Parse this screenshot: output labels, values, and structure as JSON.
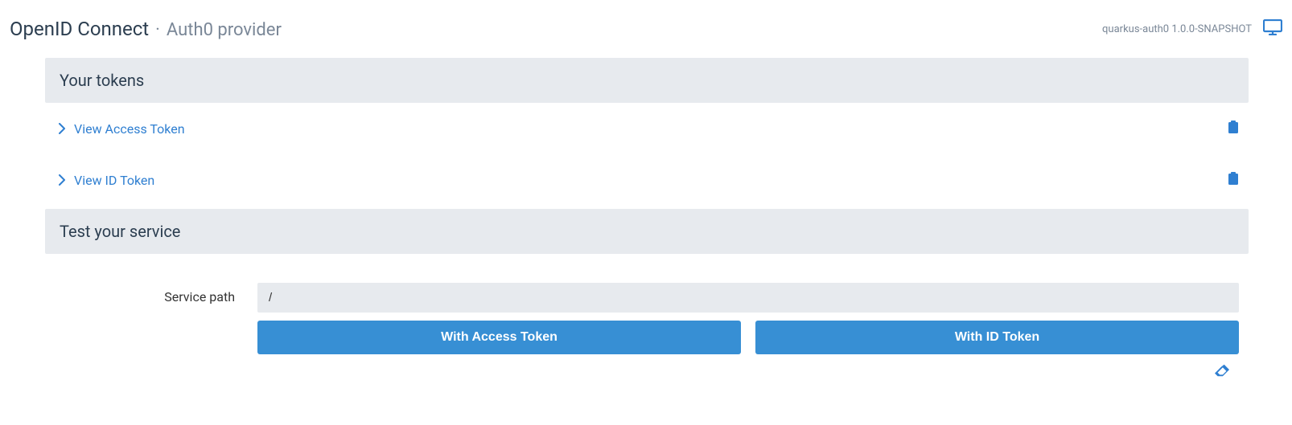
{
  "header": {
    "title": "OpenID Connect",
    "separator": "·",
    "subtitle": "Auth0 provider",
    "app_info": "quarkus-auth0 1.0.0-SNAPSHOT"
  },
  "tokens_section": {
    "heading": "Your tokens",
    "items": [
      {
        "label": "View Access Token"
      },
      {
        "label": "View ID Token"
      }
    ]
  },
  "service_section": {
    "heading": "Test your service",
    "path_label": "Service path",
    "path_value": "/",
    "buttons": {
      "access": "With Access Token",
      "id": "With ID Token"
    }
  }
}
